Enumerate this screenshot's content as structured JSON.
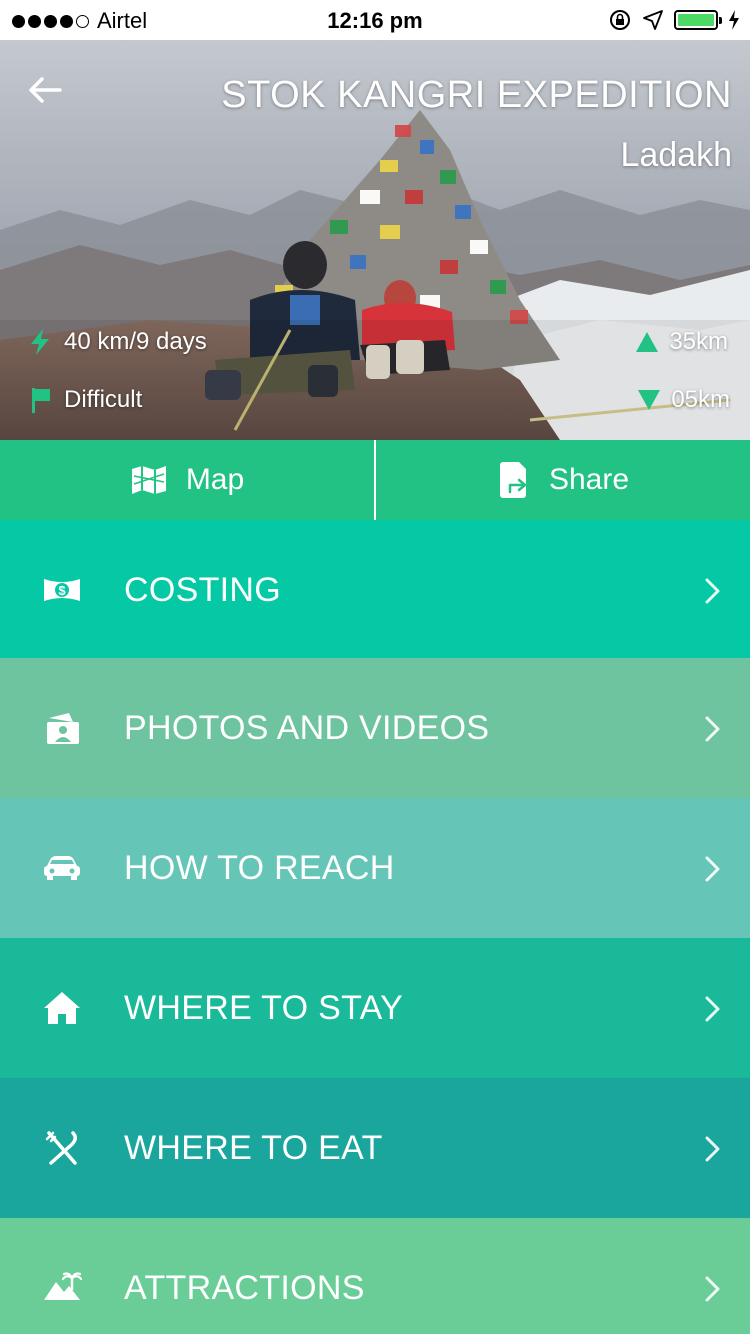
{
  "status_bar": {
    "carrier": "Airtel",
    "time": "12:16 pm",
    "signal_dots_filled": 4,
    "signal_dots_total": 5,
    "battery_level": 1.0,
    "icons": [
      "rotation-lock-icon",
      "location-arrow-icon",
      "battery-icon",
      "charging-bolt-icon"
    ]
  },
  "hero": {
    "title": "STOK KANGRI EXPEDITION",
    "subtitle": "Ladakh",
    "distance": "40 km/9 days",
    "difficulty": "Difficult",
    "ascent": "35km",
    "descent": "05km",
    "accent_color": "#22c285"
  },
  "actions": {
    "map_label": "Map",
    "share_label": "Share"
  },
  "menu": [
    {
      "label": "COSTING",
      "icon": "money-bill-icon",
      "color": "#05c9a4"
    },
    {
      "label": "PHOTOS AND VIDEOS",
      "icon": "photo-album-icon",
      "color": "#6dc49f"
    },
    {
      "label": "HOW TO REACH",
      "icon": "car-icon",
      "color": "#65c6b8"
    },
    {
      "label": "WHERE TO STAY",
      "icon": "home-icon",
      "color": "#1ab99a"
    },
    {
      "label": "WHERE TO EAT",
      "icon": "fork-knife-icon",
      "color": "#1ba69d"
    },
    {
      "label": "ATTRACTIONS",
      "icon": "palm-mountain-icon",
      "color": "#6acd97"
    }
  ]
}
